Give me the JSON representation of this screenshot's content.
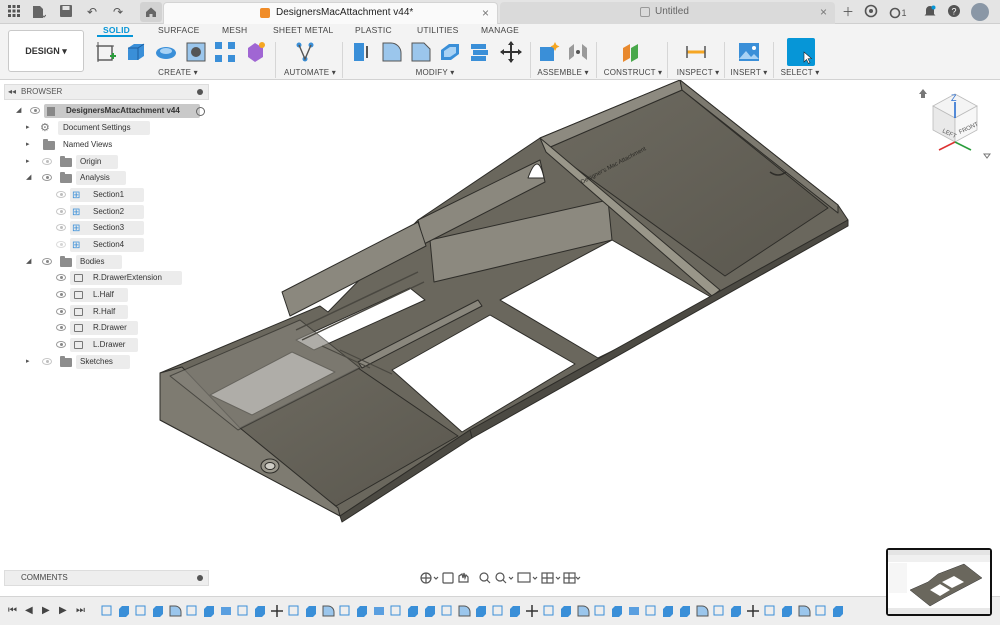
{
  "tabs": {
    "active_title": "DesignersMacAttachment v44*",
    "inactive_title": "Untitled",
    "job_count": "1"
  },
  "ribbon": {
    "workspace": "DESIGN",
    "workspace_tabs": [
      "SOLID",
      "SURFACE",
      "MESH",
      "SHEET METAL",
      "PLASTIC",
      "UTILITIES",
      "MANAGE"
    ],
    "groups": [
      "CREATE",
      "AUTOMATE",
      "MODIFY",
      "ASSEMBLE",
      "CONSTRUCT",
      "INSPECT",
      "INSERT",
      "SELECT"
    ],
    "accent": "#0696d7"
  },
  "browser": {
    "title": "BROWSER",
    "root": "DesignersMacAttachment v44",
    "items": [
      {
        "label": "Document Settings"
      },
      {
        "label": "Named Views"
      },
      {
        "label": "Origin"
      },
      {
        "label": "Analysis"
      },
      {
        "label": "Section1"
      },
      {
        "label": "Section2"
      },
      {
        "label": "Section3"
      },
      {
        "label": "Section4"
      },
      {
        "label": "Bodies"
      },
      {
        "label": "R.DrawerExtension"
      },
      {
        "label": "L.Half"
      },
      {
        "label": "R.Half"
      },
      {
        "label": "R.Drawer"
      },
      {
        "label": "L.Drawer"
      },
      {
        "label": "Sketches"
      }
    ]
  },
  "viewcube": {
    "left_face": "LEFT",
    "front_face": "FRONT",
    "up_axis": "Z"
  },
  "comments": {
    "title": "COMMENTS"
  },
  "model": {
    "engraved_text": "Designer's Mac Attachment"
  }
}
